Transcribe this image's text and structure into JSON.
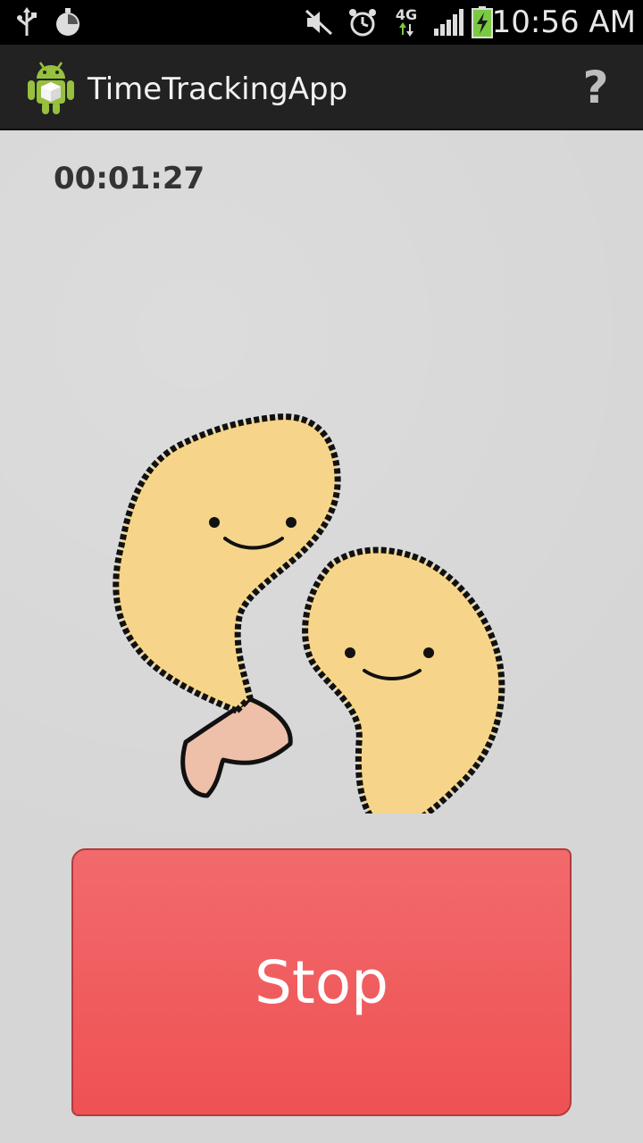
{
  "status_bar": {
    "time": "10:56 AM",
    "icons": [
      "usb-icon",
      "stopwatch-icon",
      "mute-icon",
      "alarm-icon",
      "network-4g-icon",
      "signal-icon",
      "battery-charging-icon"
    ],
    "network_label": "4G"
  },
  "action_bar": {
    "title": "TimeTrackingApp",
    "help_label": "?"
  },
  "main": {
    "elapsed_time": "00:01:27",
    "stop_label": "Stop"
  },
  "colors": {
    "action_bar_bg": "#222222",
    "stop_button": "#ef5153",
    "shrimp_body": "#f6d58a",
    "shrimp_tail": "#eec0aa"
  }
}
